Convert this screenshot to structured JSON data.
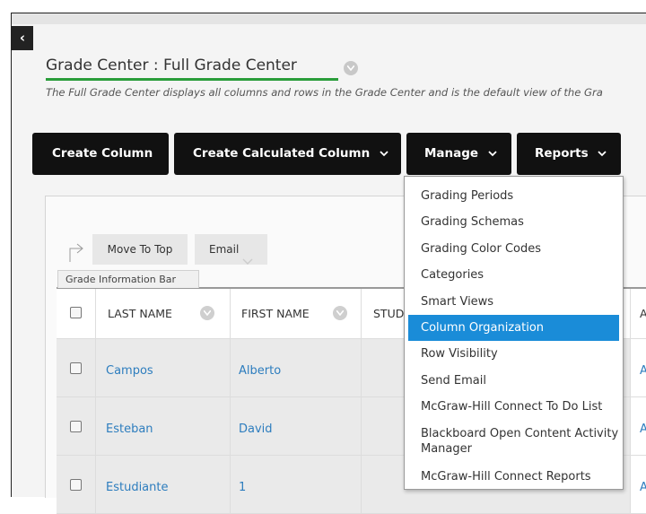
{
  "page": {
    "title": "Grade Center : Full Grade Center",
    "description": "The Full Grade Center displays all columns and rows in the Grade Center and is the default view of the Gra",
    "back_label": "‹"
  },
  "toolbar": {
    "create_column": "Create Column",
    "create_calculated_column": "Create Calculated Column",
    "manage": "Manage",
    "reports": "Reports"
  },
  "actions": {
    "move_to_top": "Move To Top",
    "email": "Email"
  },
  "info_bar": {
    "label": "Grade Information Bar"
  },
  "table": {
    "columns": [
      "LAST NAME",
      "FIRST NAME",
      "STUD",
      "A"
    ],
    "rows": [
      {
        "last": "Campos",
        "first": "Alberto",
        "extra": "A"
      },
      {
        "last": "Esteban",
        "first": "David",
        "extra": "A"
      },
      {
        "last": "Estudiante",
        "first": "1",
        "extra": "A"
      }
    ]
  },
  "manage_menu": {
    "items": [
      "Grading Periods",
      "Grading Schemas",
      "Grading Color Codes",
      "Categories",
      "Smart Views",
      "Column Organization",
      "Row Visibility",
      "Send Email",
      "McGraw-Hill Connect To Do List",
      "Blackboard Open Content Activity Manager",
      "McGraw-Hill Connect Reports"
    ],
    "selected": "Column Organization"
  },
  "colors": {
    "accent_underline": "#2a9d3a",
    "menu_selected": "#1a8cd8",
    "link": "#2d7dbe",
    "toolbar_button": "#111111"
  }
}
